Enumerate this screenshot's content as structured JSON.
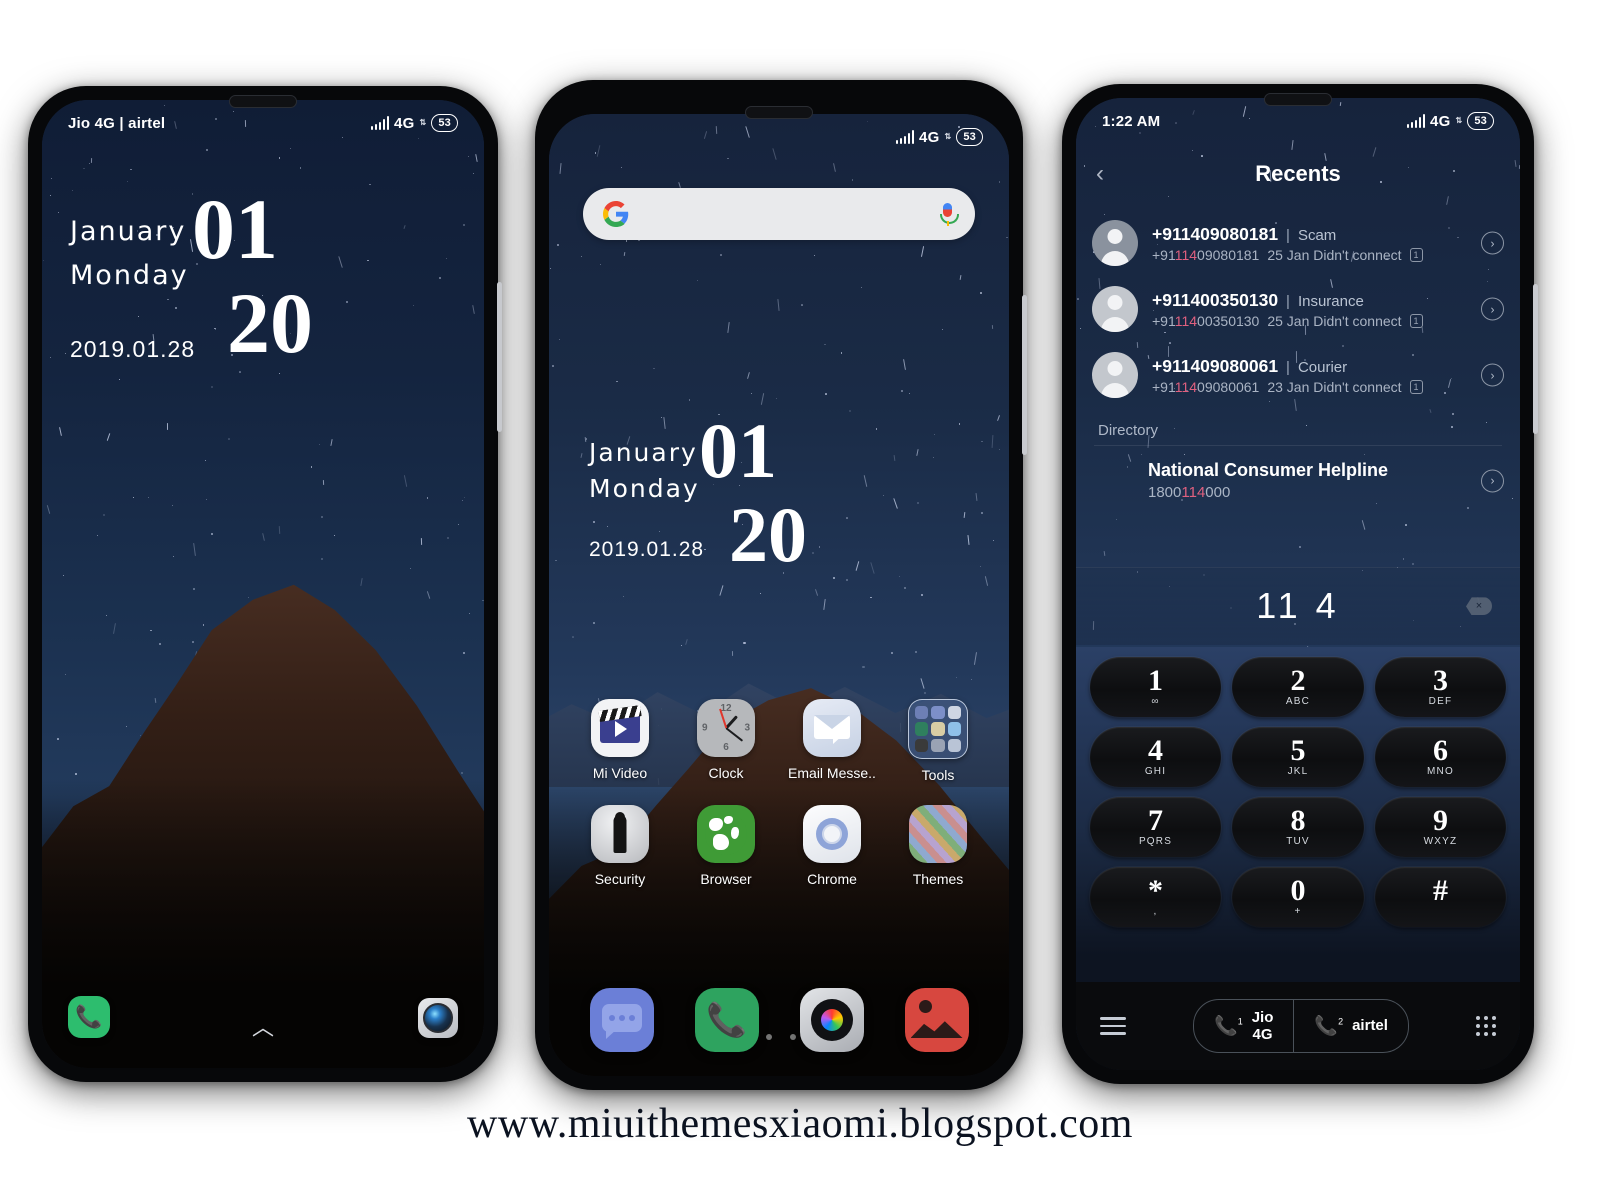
{
  "watermark": "www.miuithemesxiaomi.blogspot.com",
  "statusbar": {
    "carrier_lock": "Jio 4G | airtel",
    "time_dialer": "1:22 AM",
    "network": "4G",
    "battery": "53"
  },
  "lockscreen": {
    "month": "January",
    "weekday": "Monday",
    "date": "2019.01.28",
    "hour": "01",
    "minute": "20",
    "shortcut_phone": "phone-icon",
    "shortcut_camera": "camera-icon",
    "unlock_hint": "chevron-up-icon"
  },
  "homescreen": {
    "search_placeholder": "",
    "google_icon": "google-g-icon",
    "mic_icon": "microphone-icon",
    "month": "January",
    "weekday": "Monday",
    "date": "2019.01.28",
    "hour": "01",
    "minute": "20",
    "apps_row1": [
      {
        "label": "Mi Video",
        "icon": "mi-video-icon"
      },
      {
        "label": "Clock",
        "icon": "clock-icon"
      },
      {
        "label": "Email Messe..",
        "icon": "email-icon"
      },
      {
        "label": "Tools",
        "icon": "tools-folder-icon"
      }
    ],
    "apps_row2": [
      {
        "label": "Security",
        "icon": "security-icon"
      },
      {
        "label": "Browser",
        "icon": "browser-icon"
      },
      {
        "label": "Chrome",
        "icon": "chrome-icon"
      },
      {
        "label": "Themes",
        "icon": "themes-icon"
      }
    ],
    "page_dots": 4,
    "active_dot": 1,
    "dock": [
      {
        "label": "Messages",
        "icon": "messages-icon"
      },
      {
        "label": "Phone",
        "icon": "phone-icon"
      },
      {
        "label": "Camera",
        "icon": "camera-icon"
      },
      {
        "label": "Gallery",
        "icon": "gallery-icon"
      }
    ]
  },
  "dialer": {
    "title": "Recents",
    "back_icon": "chevron-left-icon",
    "recents": [
      {
        "number": "+911409080181",
        "tag": "Scam",
        "sub_prefix": "+91",
        "sub_match": "114",
        "sub_rest": "09080181",
        "detail": "25 Jan Didn't connect",
        "sim": "1"
      },
      {
        "number": "+911400350130",
        "tag": "Insurance",
        "sub_prefix": "+91",
        "sub_match": "114",
        "sub_rest": "00350130",
        "detail": "25 Jan Didn't connect",
        "sim": "1"
      },
      {
        "number": "+911409080061",
        "tag": "Courier",
        "sub_prefix": "+91",
        "sub_match": "114",
        "sub_rest": "09080061",
        "detail": "23 Jan Didn't connect",
        "sim": "1"
      }
    ],
    "directory_label": "Directory",
    "directory": {
      "name": "National Consumer Helpline",
      "num_prefix": "1800",
      "num_match": "114",
      "num_rest": "000"
    },
    "entered_number": "11 4",
    "backspace_icon": "backspace-icon",
    "keys": [
      {
        "digit": "1",
        "letters": "∞"
      },
      {
        "digit": "2",
        "letters": "ABC"
      },
      {
        "digit": "3",
        "letters": "DEF"
      },
      {
        "digit": "4",
        "letters": "GHI"
      },
      {
        "digit": "5",
        "letters": "JKL"
      },
      {
        "digit": "6",
        "letters": "MNO"
      },
      {
        "digit": "7",
        "letters": "PQRS"
      },
      {
        "digit": "8",
        "letters": "TUV"
      },
      {
        "digit": "9",
        "letters": "WXYZ"
      },
      {
        "digit": "*",
        "letters": ","
      },
      {
        "digit": "0",
        "letters": "+"
      },
      {
        "digit": "#",
        "letters": ""
      }
    ],
    "navbar": {
      "menu_icon": "hamburger-menu-icon",
      "sim1_label": "Jio\n4G",
      "sim1_line1": "Jio",
      "sim1_line2": "4G",
      "sim1_index": "1",
      "sim2_label": "airtel",
      "sim2_index": "2",
      "keypad_icon": "keypad-grid-icon"
    }
  },
  "colors": {
    "accent_pink": "#e0607f",
    "sky_top": "#101d36",
    "sky_mid": "#223a5c",
    "green_phone": "#2dbd6e",
    "keypad_dark": "#0d0e10"
  }
}
